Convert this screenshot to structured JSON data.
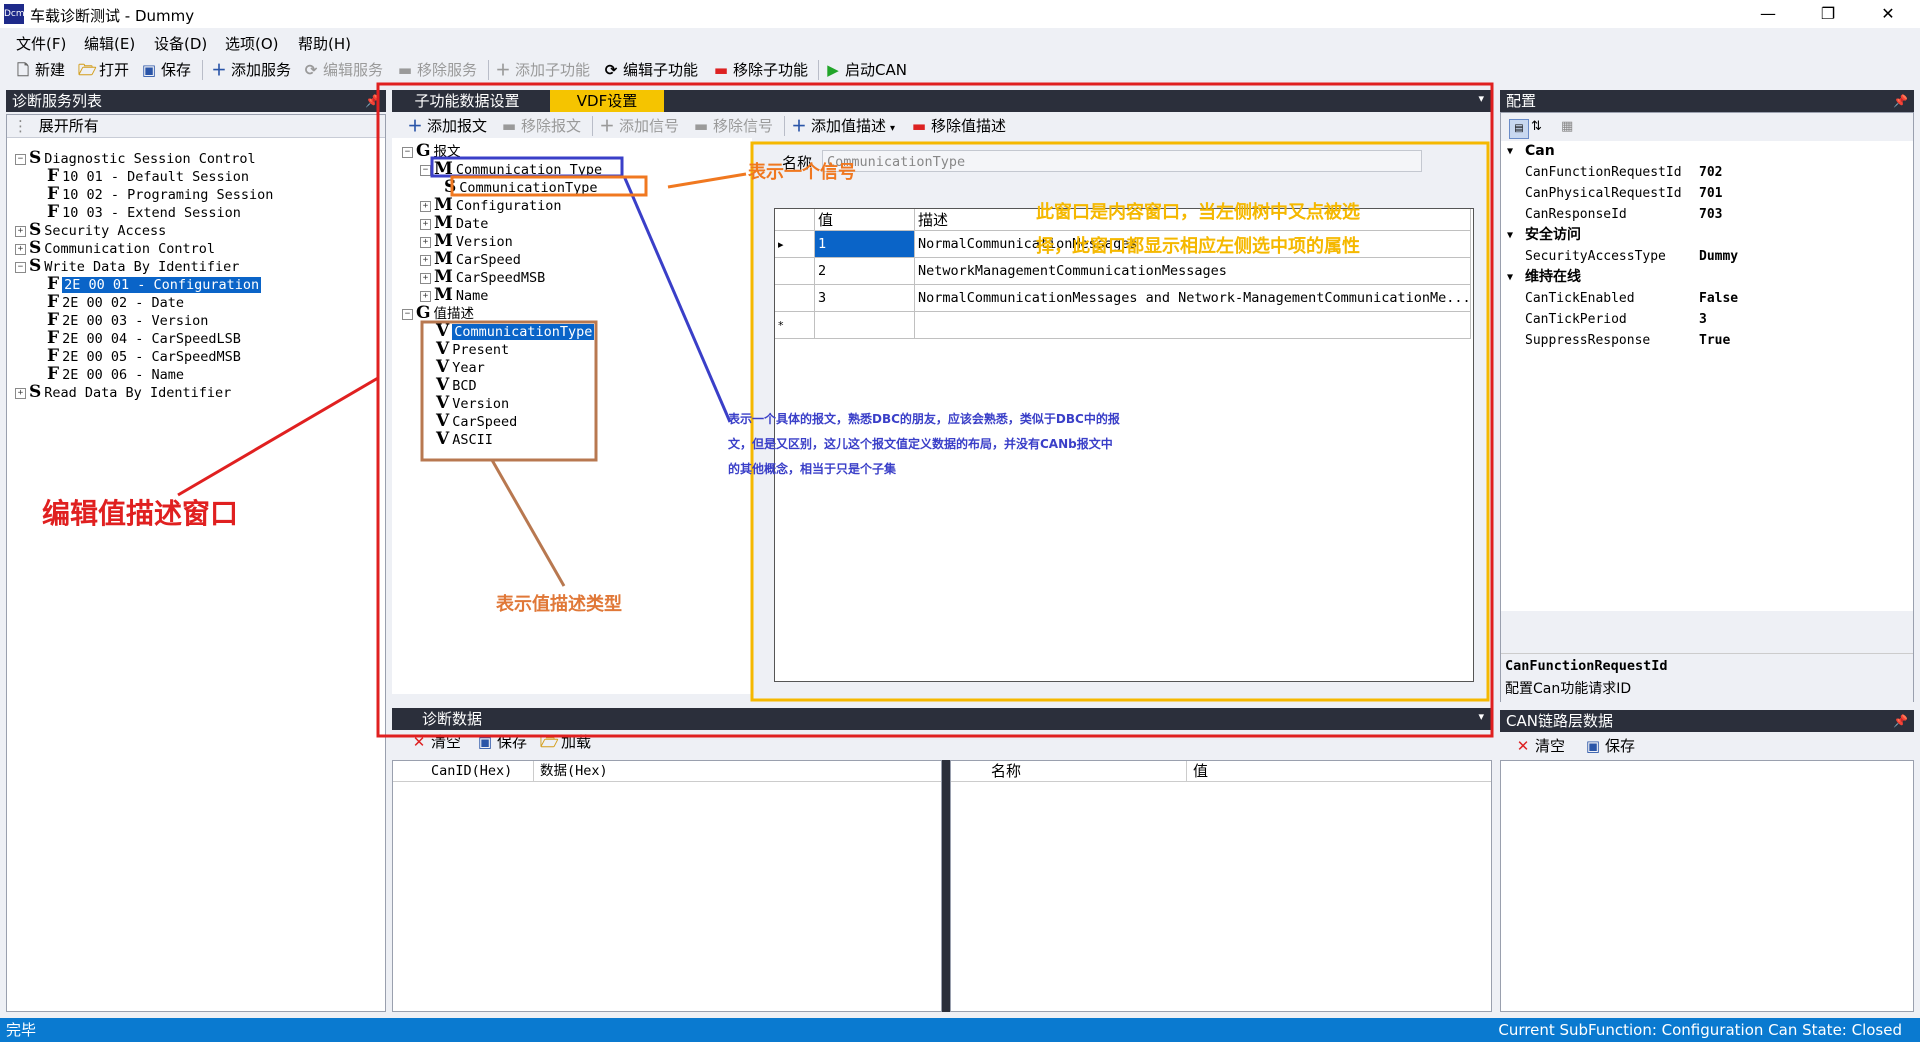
{
  "window": {
    "app_icon": "Dcm",
    "title": "车载诊断测试 - Dummy",
    "controls": [
      "—",
      "❐",
      "✕"
    ]
  },
  "menu": [
    "文件(F)",
    "编辑(E)",
    "设备(D)",
    "选项(O)",
    "帮助(H)"
  ],
  "toolbar": {
    "new": "新建",
    "open": "打开",
    "save": "保存",
    "add_service": "添加服务",
    "edit_service": "编辑服务",
    "remove_service": "移除服务",
    "add_subfunc": "添加子功能",
    "edit_subfunc": "编辑子功能",
    "remove_subfunc": "移除子功能",
    "start_can": "启动CAN"
  },
  "left_panel": {
    "title": "诊断服务列表",
    "expand_all": "展开所有",
    "tree": [
      {
        "exp": "−",
        "letter": "S",
        "text": "Diagnostic Session Control"
      },
      {
        "letter": "F",
        "text": "10 01 - Default Session"
      },
      {
        "letter": "F",
        "text": "10 02 - Programing Session"
      },
      {
        "letter": "F",
        "text": "10 03 - Extend Session"
      },
      {
        "exp": "+",
        "letter": "S",
        "text": "Security Access"
      },
      {
        "exp": "+",
        "letter": "S",
        "text": "Communication Control"
      },
      {
        "exp": "−",
        "letter": "S",
        "text": "Write Data By Identifier"
      },
      {
        "letter": "F",
        "text": "2E 00 01 - Configuration"
      },
      {
        "letter": "F",
        "text": "2E 00 02 - Date"
      },
      {
        "letter": "F",
        "text": "2E 00 03 - Version"
      },
      {
        "letter": "F",
        "text": "2E 00 04 - CarSpeedLSB"
      },
      {
        "letter": "F",
        "text": "2E 00 05 - CarSpeedMSB"
      },
      {
        "letter": "F",
        "text": "2E 00 06 - Name"
      },
      {
        "exp": "+",
        "letter": "S",
        "text": "Read Data By Identifier"
      }
    ]
  },
  "center": {
    "tabs": [
      "子功能数据设置",
      "VDF设置"
    ],
    "vdf_toolbar": {
      "add_message": "添加报文",
      "remove_message": "移除报文",
      "add_signal": "添加信号",
      "remove_signal": "移除信号",
      "add_value_desc": "添加值描述",
      "remove_value_desc": "移除值描述"
    },
    "tree": {
      "group1": "报文",
      "group1_letter": "G",
      "messages": [
        {
          "exp": "−",
          "letter": "M",
          "text": "Communication Type"
        },
        {
          "letter": "S",
          "text": "CommunicationType"
        },
        {
          "exp": "+",
          "letter": "M",
          "text": "Configuration"
        },
        {
          "exp": "+",
          "letter": "M",
          "text": "Date"
        },
        {
          "exp": "+",
          "letter": "M",
          "text": "Version"
        },
        {
          "exp": "+",
          "letter": "M",
          "text": "CarSpeed"
        },
        {
          "exp": "+",
          "letter": "M",
          "text": "CarSpeedMSB"
        },
        {
          "exp": "+",
          "letter": "M",
          "text": "Name"
        }
      ],
      "group2": "值描述",
      "group2_letter": "G",
      "values": [
        {
          "letter": "V",
          "text": "CommunicationType"
        },
        {
          "letter": "V",
          "text": "Present"
        },
        {
          "letter": "V",
          "text": "Year"
        },
        {
          "letter": "V",
          "text": "BCD"
        },
        {
          "letter": "V",
          "text": "Version"
        },
        {
          "letter": "V",
          "text": "CarSpeed"
        },
        {
          "letter": "V",
          "text": "ASCII"
        }
      ]
    },
    "content": {
      "name_label": "名称",
      "name_value": "CommunicationType",
      "grid_headers": [
        "值",
        "描述"
      ],
      "rows": [
        {
          "marker": "▸",
          "value": "1",
          "desc": "NormalCommunicationMessages"
        },
        {
          "marker": "",
          "value": "2",
          "desc": "NetworkManagementCommunicationMessages"
        },
        {
          "marker": "",
          "value": "3",
          "desc": "NormalCommunicationMessages and Network-ManagementCommunicationMe..."
        },
        {
          "marker": "*",
          "value": "",
          "desc": ""
        }
      ]
    }
  },
  "diag": {
    "title": "诊断数据",
    "clear": "清空",
    "save": "保存",
    "load": "加载",
    "left_headers": [
      "CanID(Hex)",
      "数据(Hex)"
    ],
    "right_headers": [
      "名称",
      "值"
    ]
  },
  "right_panel": {
    "title": "配置",
    "sections": [
      {
        "name": "Can",
        "props": [
          [
            "CanFunctionRequestId",
            "702"
          ],
          [
            "CanPhysicalRequestId",
            "701"
          ],
          [
            "CanResponseId",
            "703"
          ]
        ]
      },
      {
        "name": "安全访问",
        "props": [
          [
            "SecurityAccessType",
            "Dummy"
          ]
        ]
      },
      {
        "name": "维持在线",
        "props": [
          [
            "CanTickEnabled",
            "False"
          ],
          [
            "CanTickPeriod",
            "3"
          ],
          [
            "SuppressResponse",
            "True"
          ]
        ]
      }
    ],
    "desc_title": "CanFunctionRequestId",
    "desc_text": "配置Can功能请求ID"
  },
  "can_panel": {
    "title": "CAN链路层数据",
    "clear": "清空",
    "save": "保存"
  },
  "status": {
    "left": "完毕",
    "right": "Current SubFunction: Configuration  Can State: Closed"
  },
  "annotations": {
    "edit_window": "编辑值描述窗口",
    "signal": "表示一个信号",
    "content_window_1": "此窗口是内容窗口，当左侧树中又点被选",
    "content_window_2": "择，此窗口都显示相应左侧选中项的属性",
    "message_1": "表示一个具体的报文，熟悉DBC的朋友，应该会熟悉，类似于DBC中的报",
    "message_2": "文，但是又区别，这儿这个报文值定义数据的布局，并没有CANb报文中",
    "message_3": "的其他概念，相当于只是个子集",
    "value_type": "表示值描述类型"
  },
  "colors": {
    "annot_red": "#e02020",
    "annot_blue": "#3a3fc8",
    "annot_orange": "#f07820",
    "annot_brown": "#b87850",
    "annot_yellow": "#f5b800",
    "selection": "#0a64c8",
    "status_bg": "#0a7ad0"
  }
}
